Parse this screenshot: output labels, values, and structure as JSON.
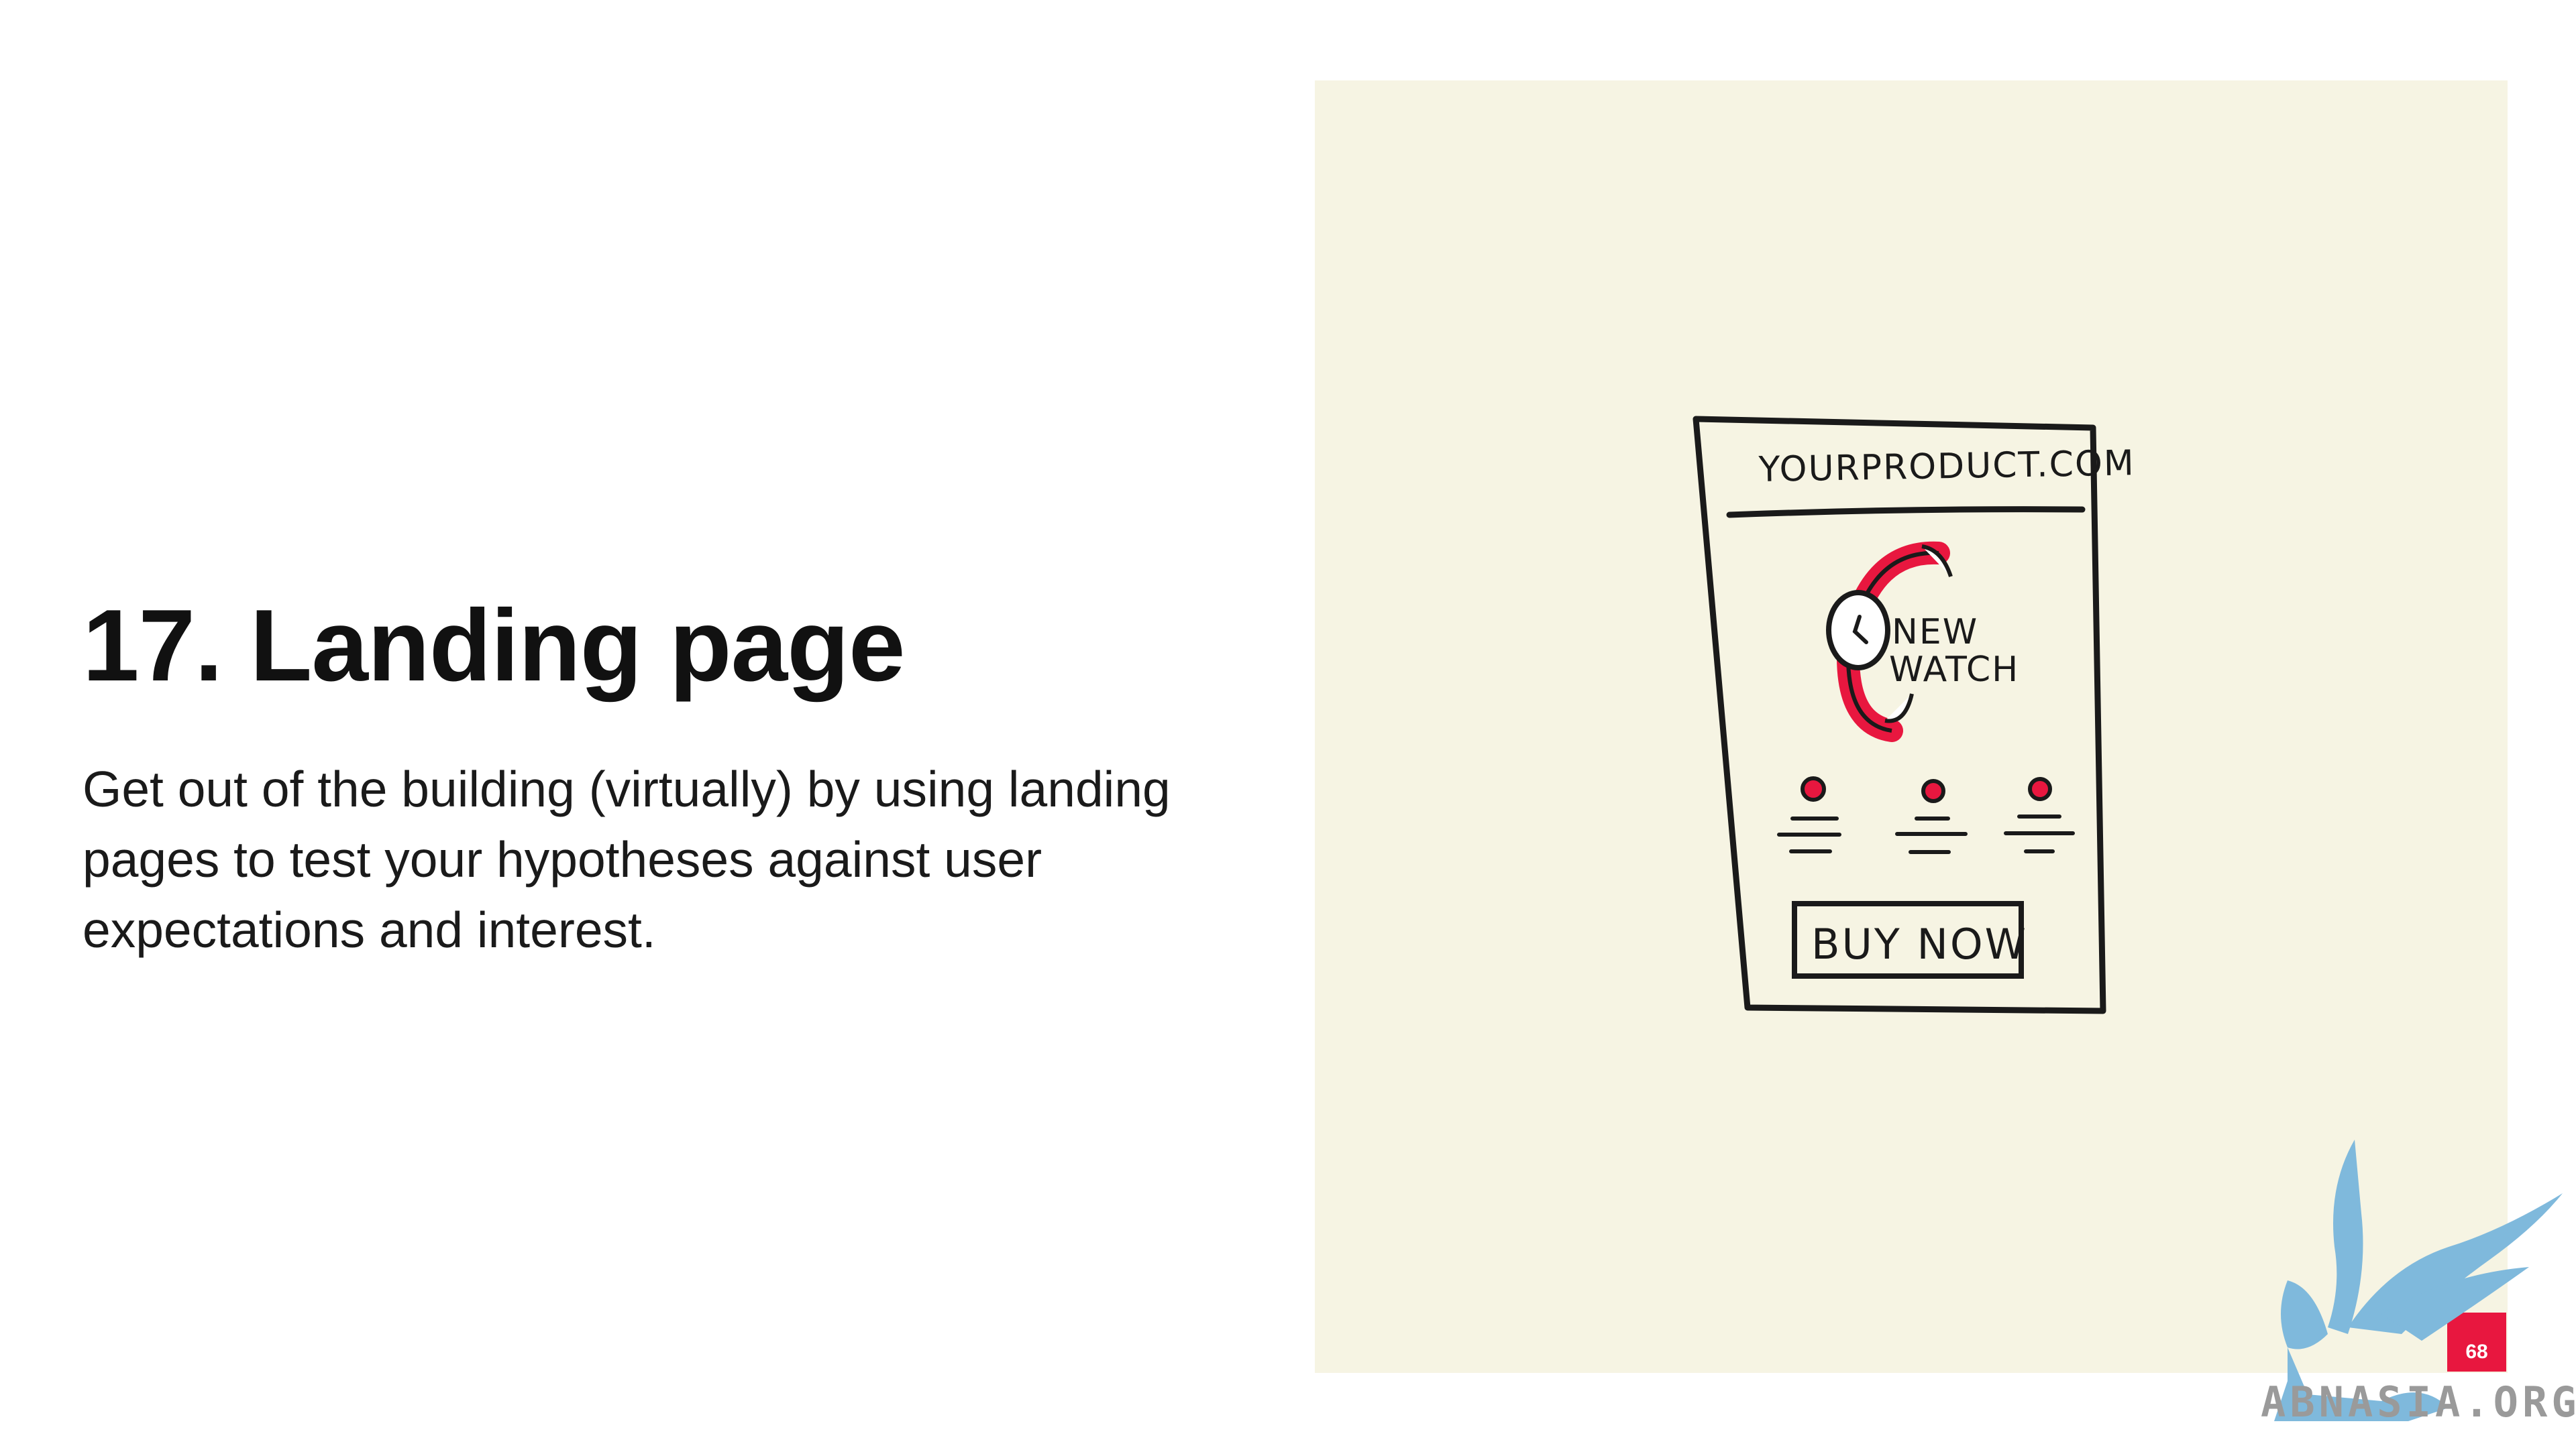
{
  "slide": {
    "title": "17. Landing page",
    "body_lines": [
      "Get out of the building (virtually) by using landing",
      "pages to test your hypotheses against user",
      "expectations and interest."
    ],
    "page_number": "68"
  },
  "illustration": {
    "url_text": "YOURPRODUCT.COM",
    "product_line1": "NEW",
    "product_line2": "WATCH",
    "button_text": "BUY NOW",
    "accent_color": "#e8173f",
    "panel_color": "#f6f4e3"
  },
  "watermark": {
    "text": "ABNASIA.ORG",
    "icon": "griffin-logo",
    "color": "#7fb9dc"
  }
}
